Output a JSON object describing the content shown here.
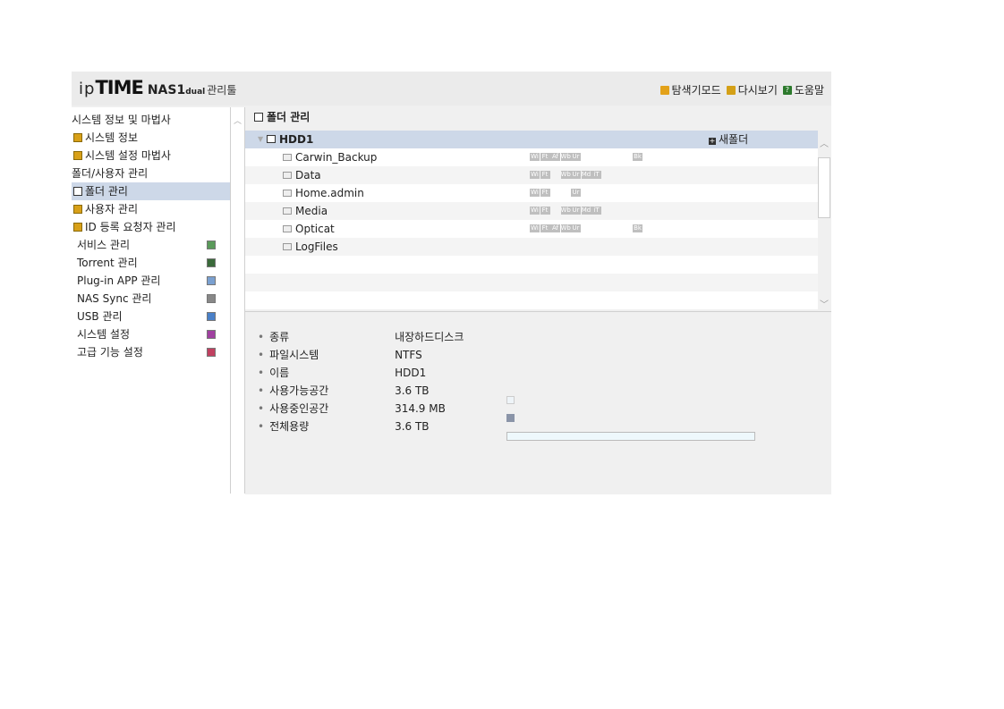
{
  "header": {
    "logo_ip": "ip",
    "logo_time": "TIME",
    "logo_model": "NAS1",
    "logo_dual": "dual",
    "logo_tool": "관리툴",
    "links": [
      {
        "label": "탐색기모드",
        "icon": "explorer-icon",
        "color": "#e3a21a"
      },
      {
        "label": "다시보기",
        "icon": "refresh-icon",
        "color": "#d4a017"
      },
      {
        "label": "도움말",
        "icon": "help-icon",
        "color": "#2d7a2d"
      }
    ]
  },
  "sidebar": {
    "items": [
      {
        "label": "시스템 정보 및 마법사",
        "type": "group"
      },
      {
        "label": "시스템 정보",
        "type": "child",
        "icon": "chart-icon"
      },
      {
        "label": "시스템 설정 마법사",
        "type": "child",
        "icon": "chart-icon"
      },
      {
        "label": "폴더/사용자 관리",
        "type": "group"
      },
      {
        "label": "폴더 관리",
        "type": "child",
        "icon": "folder-icon",
        "selected": true
      },
      {
        "label": "사용자 관리",
        "type": "child",
        "icon": "folder-icon"
      },
      {
        "label": "ID 등록 요청자 관리",
        "type": "child",
        "icon": "folder-icon"
      },
      {
        "label": "서비스 관리",
        "type": "section",
        "icon_color": "#3a7a3a"
      },
      {
        "label": "Torrent 관리",
        "type": "section",
        "icon_color": "#3a6a3a"
      },
      {
        "label": "Plug-in APP 관리",
        "type": "section",
        "icon_color": "#3a70b0"
      },
      {
        "label": "NAS Sync 관리",
        "type": "section",
        "icon_color": "#555555"
      },
      {
        "label": "USB 관리",
        "type": "section",
        "icon_color": "#3070c0"
      },
      {
        "label": "시스템 설정",
        "type": "section",
        "icon_color": "#8a2a8a"
      },
      {
        "label": "고급 기능 설정",
        "type": "section",
        "icon_color": "#b02a4a"
      }
    ]
  },
  "main": {
    "title": "폴더 관리",
    "disk": "HDD1",
    "new_folder": "새폴더",
    "folders": [
      {
        "name": "Carwin_Backup",
        "badges": [
          "Wi",
          "Ft",
          "Af",
          "Wb",
          "Ur",
          "",
          "",
          "",
          "",
          "",
          "Bk"
        ]
      },
      {
        "name": "Data",
        "badges": [
          "Wi",
          "Ft",
          "",
          "Wb",
          "Ur",
          "Md",
          "iT"
        ]
      },
      {
        "name": "Home.admin",
        "badges": [
          "Wi",
          "Ft",
          "",
          "",
          "Ur"
        ]
      },
      {
        "name": "Media",
        "badges": [
          "Wi",
          "Ft",
          "",
          "Wb",
          "Ur",
          "Md",
          "iT"
        ]
      },
      {
        "name": "Opticat",
        "badges": [
          "Wi",
          "Ft",
          "Af",
          "Wb",
          "Ur",
          "",
          "",
          "",
          "",
          "",
          "Bk"
        ]
      },
      {
        "name": "LogFiles",
        "badges": []
      }
    ]
  },
  "info": {
    "rows": [
      {
        "label": "종류",
        "value": "내장하드디스크"
      },
      {
        "label": "파일시스템",
        "value": "NTFS"
      },
      {
        "label": "이름",
        "value": "HDD1"
      },
      {
        "label": "사용가능공간",
        "value": "3.6 TB",
        "swatch_color": "#eef4f8"
      },
      {
        "label": "사용중인공간",
        "value": "314.9 MB",
        "swatch_color": "#8a94a8"
      },
      {
        "label": "전체용량",
        "value": "3.6 TB",
        "used_fraction": 0.0001
      }
    ]
  }
}
